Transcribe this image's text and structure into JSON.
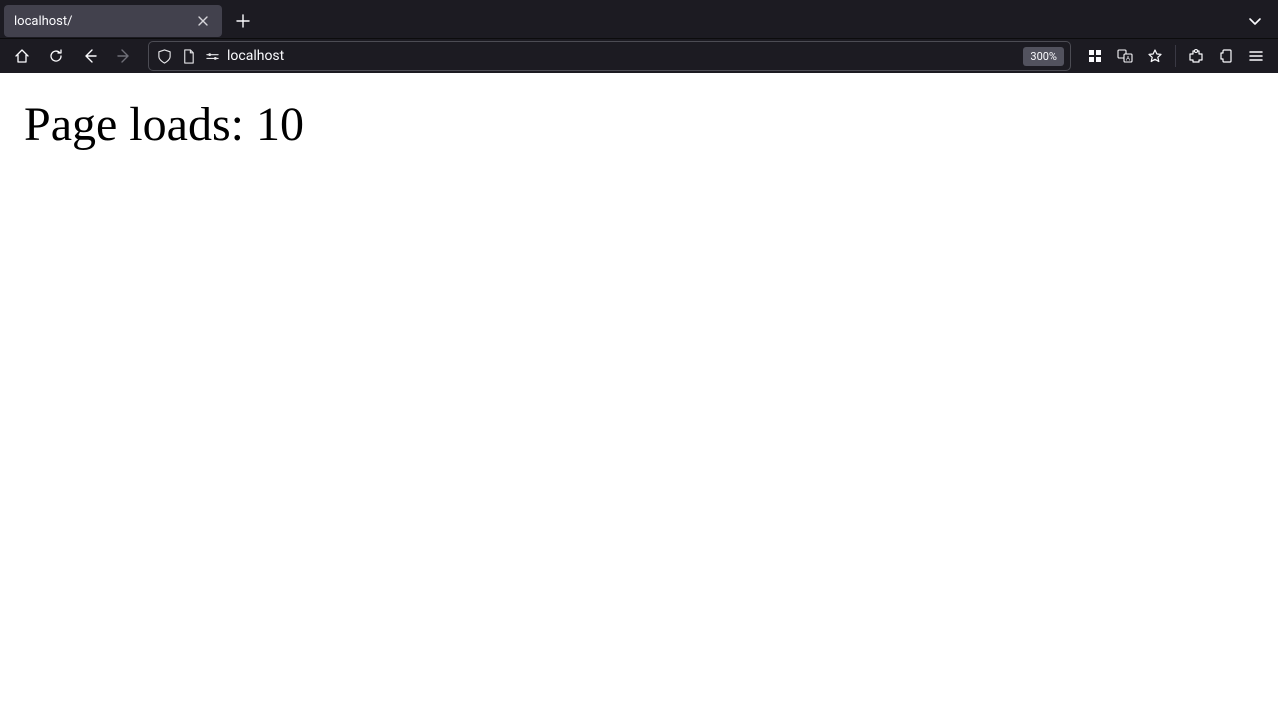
{
  "tabs": [
    {
      "title": "localhost/"
    }
  ],
  "address_bar": {
    "url": "localhost",
    "zoom": "300%"
  },
  "page": {
    "heading": "Page loads: 10"
  }
}
